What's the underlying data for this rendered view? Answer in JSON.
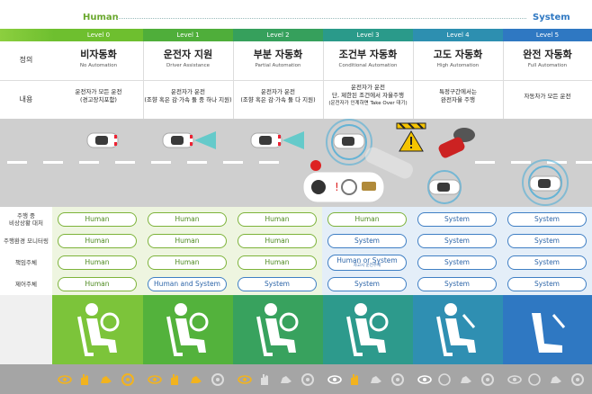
{
  "scale": {
    "left": "Human",
    "right": "System"
  },
  "levels": [
    {
      "label": "Level 0",
      "title": "비자동화",
      "subtitle": "No Automation",
      "content": [
        "운전자가 모든 운전",
        "(경고장치포함)"
      ],
      "color": "#6ebf2f"
    },
    {
      "label": "Level 1",
      "title": "운전자 지원",
      "subtitle": "Driver Assistance",
      "content": [
        "운전자가 운전",
        "(조향 혹은 감·가속 둘 중 하나 지원)"
      ],
      "color": "#4fae3a"
    },
    {
      "label": "Level 2",
      "title": "부분 자동화",
      "subtitle": "Partial Automation",
      "content": [
        "운전자가 운전",
        "(조향 혹은 감·가속 둘 다 지원)"
      ],
      "color": "#36a05c"
    },
    {
      "label": "Level 3",
      "title": "조건부 자동화",
      "subtitle": "Conditional Automation",
      "content": [
        "운전자가 운전",
        "단, 제한된 조건에서 자율주행",
        "(운전자가 인계하면 Take Over 대기)"
      ],
      "color": "#2a9a8a"
    },
    {
      "label": "Level 4",
      "title": "고도 자동화",
      "subtitle": "High Automation",
      "content": [
        "특정구간에서는",
        "완전자율 주행"
      ],
      "color": "#2d8fb0"
    },
    {
      "label": "Level 5",
      "title": "완전 자동화",
      "subtitle": "Full Automation",
      "content": [
        "자동차가 모든 운전"
      ],
      "color": "#2f78c2"
    }
  ],
  "row_labels": {
    "definition": "정의",
    "content": "내용",
    "fallback": [
      "주행 중",
      "비상상황 대처"
    ],
    "monitoring": "주행환경 모니터링",
    "responsibility": "책임주체",
    "control": "제어주체"
  },
  "rows": {
    "fallback": [
      "Human",
      "Human",
      "Human",
      "Human",
      "System",
      "System"
    ],
    "monitoring": [
      "Human",
      "Human",
      "Human",
      "System",
      "System",
      "System"
    ],
    "responsibility": [
      "Human",
      "Human",
      "Human",
      "Human or System",
      "System",
      "System"
    ],
    "responsibility_note": "자고시 운전주체",
    "control_level0": "Human",
    "control_level1": "Human and System",
    "control_rest": [
      "System",
      "System",
      "System",
      "System"
    ]
  },
  "colors": {
    "human": "#7db33a",
    "system": "#3f7fc4",
    "road": "#cfcfcf",
    "strip": "#a5a5a5"
  },
  "icons": [
    "eye-icon",
    "hand-icon",
    "foot-icon",
    "steering-wheel-icon",
    "car-icon",
    "warning-icon",
    "person-seated-icon"
  ]
}
